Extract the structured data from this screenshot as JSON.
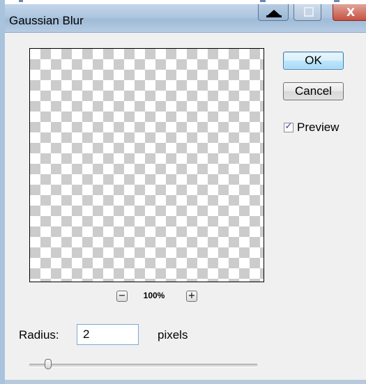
{
  "window": {
    "title": "Gaussian Blur"
  },
  "titlebar_buttons": {
    "minimize_icon": "triangle-up-minimize-icon",
    "maximize_icon": "maximize-icon",
    "close_label": "X"
  },
  "preview": {
    "pattern": "transparency-checkerboard",
    "zoom_out_label": "−",
    "zoom_in_label": "+",
    "zoom_level": "100%"
  },
  "buttons": {
    "ok_label": "OK",
    "cancel_label": "Cancel"
  },
  "preview_toggle": {
    "label": "Preview",
    "checked": true,
    "check_glyph": "✓"
  },
  "radius": {
    "label": "Radius:",
    "value": "2",
    "unit": "pixels",
    "slider_position_fraction": 0.07
  },
  "colors": {
    "window_bg": "#f0f0f0",
    "titlebar": "#aec6df",
    "ok_accent": "#3c7fb1",
    "close_red": "#c7513f"
  }
}
